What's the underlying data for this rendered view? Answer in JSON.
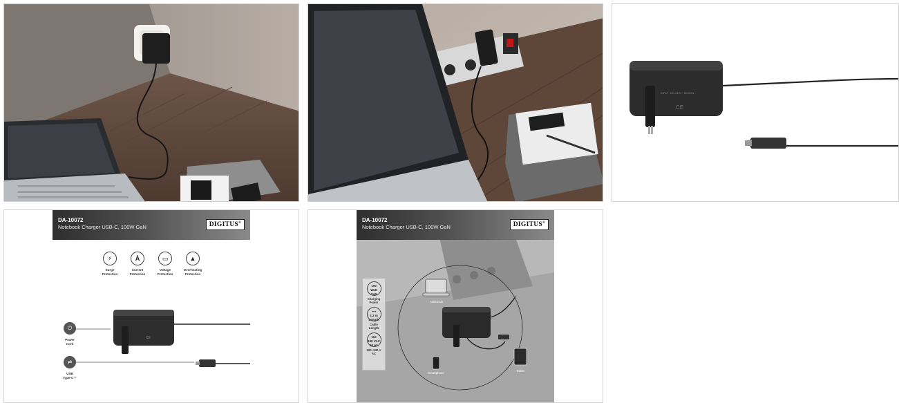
{
  "sheet_light": {
    "model": "DA-10072",
    "subtitle": "Notebook Charger USB-C, 100W GaN",
    "brand": "DIGITUS",
    "protections": [
      {
        "icon": "surge-icon",
        "glyph": "⚡",
        "label1": "Surge",
        "label2": "Protection"
      },
      {
        "icon": "current-icon",
        "glyph": "Ȧ",
        "label1": "Current",
        "label2": "Protection"
      },
      {
        "icon": "voltage-icon",
        "glyph": "▭",
        "label1": "Voltage",
        "label2": "Protection"
      },
      {
        "icon": "overheating-icon",
        "glyph": "▲",
        "label1": "Overheating",
        "label2": "Protection"
      }
    ],
    "callout_power": {
      "line1": "Power",
      "line2": "Cord"
    },
    "callout_usb": {
      "line1": "USB",
      "line2": "Type-C™"
    }
  },
  "sheet_dark": {
    "model": "DA-10072",
    "subtitle": "Notebook Charger USB-C, 100W GaN",
    "brand": "DIGITUS",
    "side": [
      {
        "badge1": "100",
        "badge2": "Watt",
        "badge3": "GaN",
        "label1": "Charging",
        "label2": "Power"
      },
      {
        "badge1": "⟷",
        "badge2": "1.2 m",
        "badge3": "Length",
        "label1": "Cable",
        "label2": "Length"
      },
      {
        "badge1": "110",
        "badge2": "240 VAC",
        "badge3": "60 Hz",
        "label1": "100~240 V",
        "label2": "AC"
      }
    ],
    "devices": {
      "notebook": "Notebook",
      "smartphone": "Smartphone",
      "tablet": "Tablet"
    }
  }
}
